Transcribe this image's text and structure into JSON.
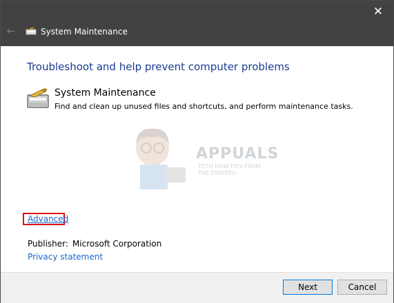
{
  "window": {
    "title": "System Maintenance",
    "close_glyph": "✕",
    "back_glyph": "←",
    "icons": {
      "close": "close-icon",
      "back": "back-arrow-icon",
      "app": "system-maintenance-icon"
    }
  },
  "main": {
    "heading": "Troubleshoot and help prevent computer problems",
    "task": {
      "title": "System Maintenance",
      "description": "Find and clean up unused files and shortcuts, and perform maintenance tasks."
    },
    "advanced_link": "Advanced",
    "publisher_label": "Publisher:",
    "publisher_value": "Microsoft Corporation",
    "privacy_link": "Privacy statement"
  },
  "watermark": {
    "brand": "APPUALS",
    "tagline": "TECH HOW-TO'S FROM THE EXPERTS!"
  },
  "footer": {
    "next_label": "Next",
    "cancel_label": "Cancel"
  },
  "colors": {
    "titlebar": "#424242",
    "heading": "#1a3b93",
    "link": "#1a66cc",
    "highlight_box": "#e01010",
    "footer": "#f0f0f0"
  }
}
